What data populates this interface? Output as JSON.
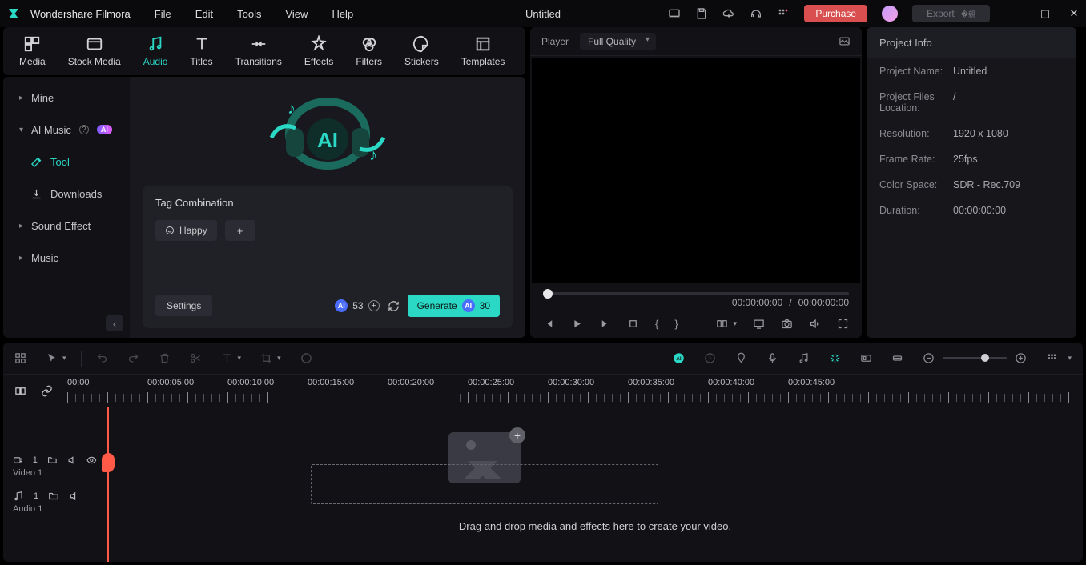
{
  "app": {
    "name": "Wondershare Filmora",
    "document": "Untitled"
  },
  "menubar": [
    "File",
    "Edit",
    "Tools",
    "View",
    "Help"
  ],
  "titlebar_buttons": {
    "purchase": "Purchase",
    "export": "Export"
  },
  "tabs": [
    "Media",
    "Stock Media",
    "Audio",
    "Titles",
    "Transitions",
    "Effects",
    "Filters",
    "Stickers",
    "Templates"
  ],
  "tabs_active": "Audio",
  "sidebar": {
    "items": [
      {
        "label": "Mine",
        "type": "group"
      },
      {
        "label": "AI Music",
        "type": "group",
        "badge": "AI",
        "info": true
      },
      {
        "label": "Tool",
        "type": "sub",
        "active": true
      },
      {
        "label": "Downloads",
        "type": "sub"
      },
      {
        "label": "Sound Effect",
        "type": "group"
      },
      {
        "label": "Music",
        "type": "group"
      }
    ]
  },
  "aimusic": {
    "section_title": "Tag Combination",
    "tags": [
      "Happy"
    ],
    "settings_label": "Settings",
    "credits": "53",
    "generate_label": "Generate",
    "generate_cost": "30"
  },
  "player": {
    "title": "Player",
    "quality": "Full Quality",
    "current": "00:00:00:00",
    "sep": "/",
    "total": "00:00:00:00"
  },
  "project": {
    "header": "Project Info",
    "rows": [
      {
        "k": "Project Name:",
        "v": "Untitled"
      },
      {
        "k": "Project Files Location:",
        "v": "/"
      },
      {
        "k": "Resolution:",
        "v": "1920 x 1080"
      },
      {
        "k": "Frame Rate:",
        "v": "25fps"
      },
      {
        "k": "Color Space:",
        "v": "SDR - Rec.709"
      },
      {
        "k": "Duration:",
        "v": "00:00:00:00"
      }
    ]
  },
  "timeline": {
    "ruler": [
      "00:00",
      "00:00:05:00",
      "00:00:10:00",
      "00:00:15:00",
      "00:00:20:00",
      "00:00:25:00",
      "00:00:30:00",
      "00:00:35:00",
      "00:00:40:00",
      "00:00:45:00"
    ],
    "tracks": [
      {
        "name": "Video 1",
        "count": "1"
      },
      {
        "name": "Audio 1",
        "count": "1"
      }
    ],
    "drop_hint": "Drag and drop media and effects here to create your video."
  }
}
